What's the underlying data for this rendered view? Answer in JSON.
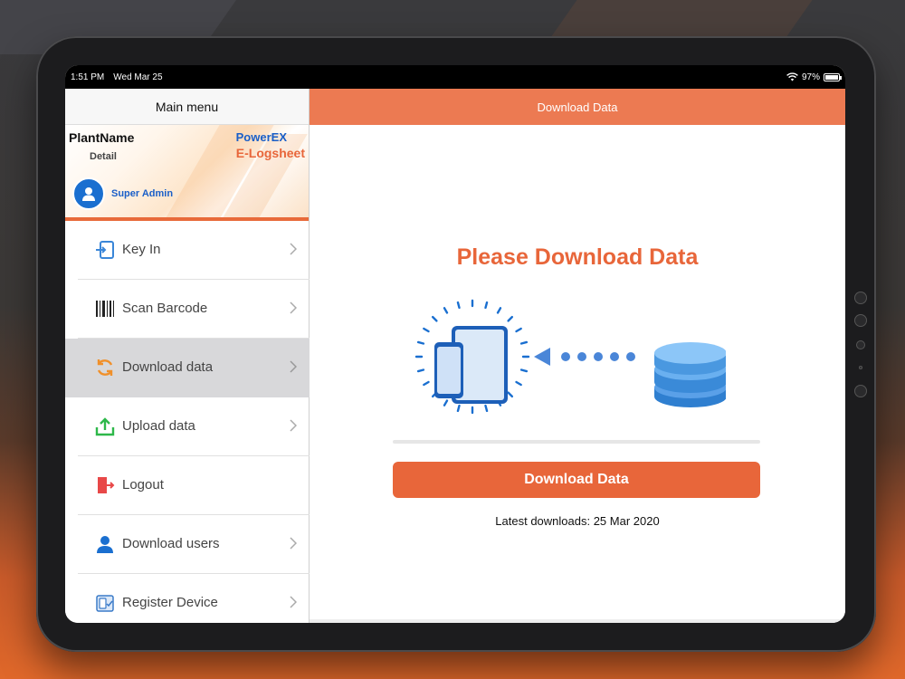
{
  "status_bar": {
    "time": "1:51 PM",
    "date": "Wed Mar 25",
    "battery": "97%",
    "battery_level": 0.97
  },
  "sidebar": {
    "title": "Main menu",
    "profile": {
      "plant_name": "PlantName",
      "detail": "Detail",
      "brand_line1": "PowerEX",
      "brand_line2": "E-Logsheet",
      "user": "Super Admin"
    },
    "items": [
      {
        "label": "Key In",
        "icon": "key-in-icon",
        "chevron": true,
        "active": false
      },
      {
        "label": "Scan Barcode",
        "icon": "barcode-icon",
        "chevron": true,
        "active": false
      },
      {
        "label": "Download data",
        "icon": "sync-icon",
        "chevron": true,
        "active": true
      },
      {
        "label": "Upload data",
        "icon": "upload-icon",
        "chevron": true,
        "active": false
      },
      {
        "label": "Logout",
        "icon": "logout-icon",
        "chevron": false,
        "active": false
      },
      {
        "label": "Download users",
        "icon": "user-icon",
        "chevron": true,
        "active": false
      },
      {
        "label": "Register Device",
        "icon": "register-device-icon",
        "chevron": true,
        "active": false
      }
    ]
  },
  "main": {
    "header_title": "Download Data",
    "heading": "Please Download Data",
    "progress": 0,
    "button_label": "Download Data",
    "latest_downloads": "Latest downloads: 25 Mar 2020"
  },
  "colors": {
    "accent": "#e8663a",
    "header": "#ec7a52",
    "brand_blue": "#1a5fc8"
  }
}
